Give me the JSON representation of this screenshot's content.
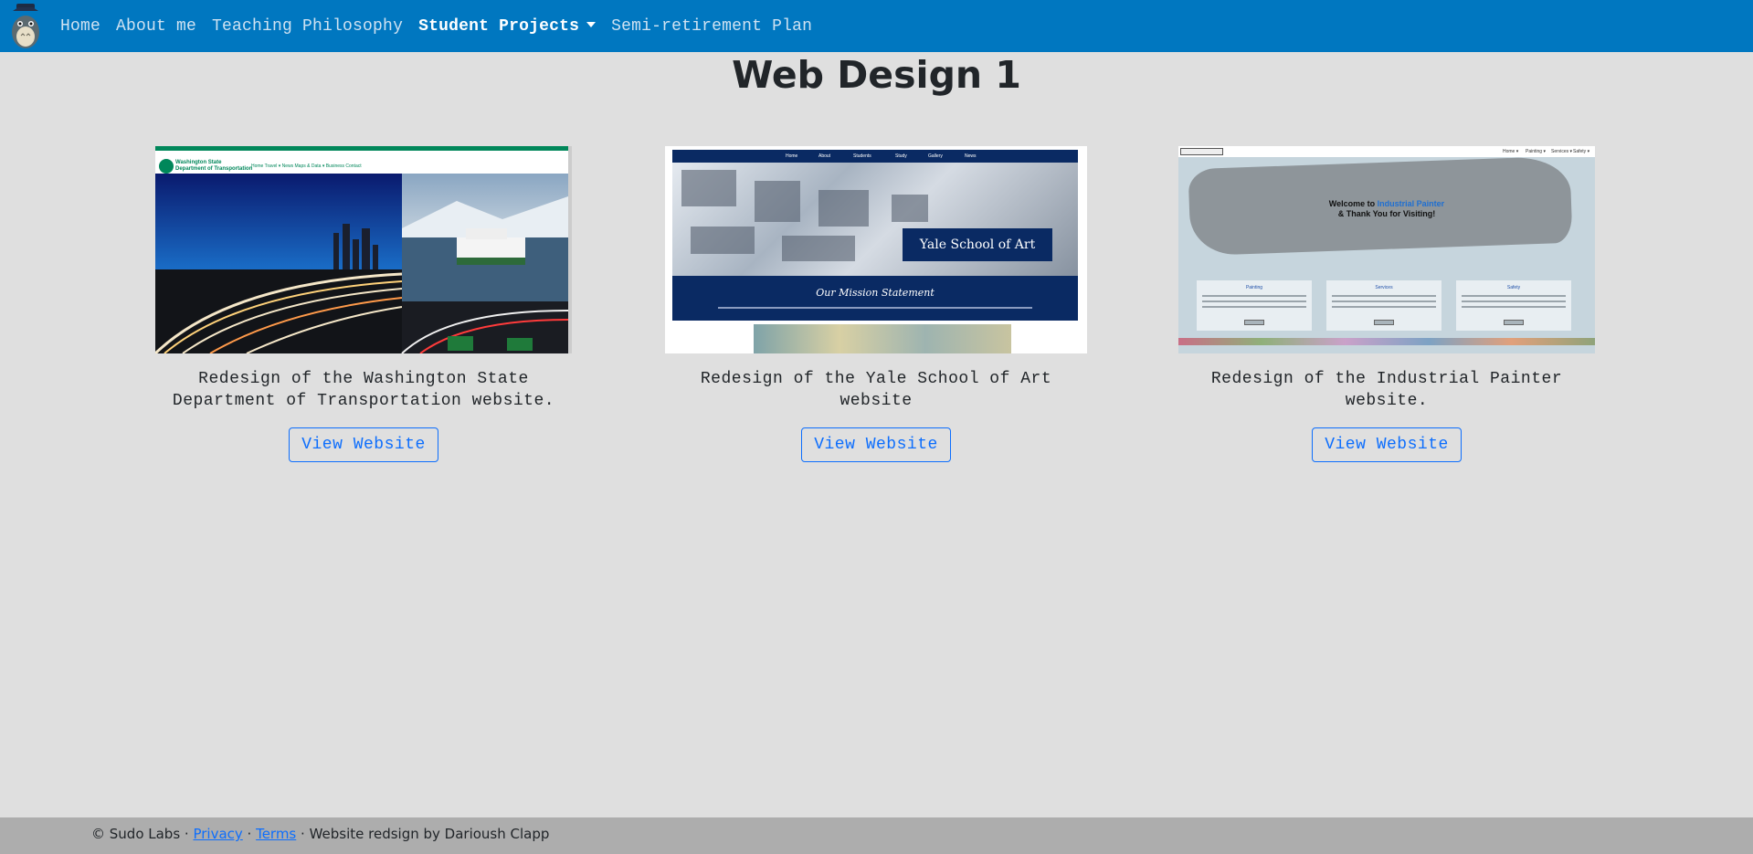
{
  "nav": {
    "items": [
      {
        "label": "Home"
      },
      {
        "label": "About me"
      },
      {
        "label": "Teaching Philosophy"
      },
      {
        "label": "Student Projects",
        "active": true,
        "dropdown": true
      },
      {
        "label": "Semi-retirement Plan"
      }
    ],
    "brand_icon": "totoro-logo-icon",
    "background": "#0077c0"
  },
  "page": {
    "title": "Web Design 1"
  },
  "projects": [
    {
      "caption_line1": "Redesign of the Washington State",
      "caption_line2": "Department of Transportation website.",
      "button": "View Website",
      "thumb": {
        "logo_line1": "Washington State",
        "logo_line2": "Department of Transportation",
        "links": "Home   Travel ▾   News   Maps & Data ▾   Business   Contact"
      }
    },
    {
      "caption_line1": "Redesign of the Yale School of Art website",
      "caption_line2": "",
      "button": "View Website",
      "thumb": {
        "nav": [
          "Home",
          "About",
          "Students",
          "Study",
          "Gallery",
          "News"
        ],
        "box_title": "Yale School of Art",
        "band_title": "Our Mission Statement"
      }
    },
    {
      "caption_line1": "Redesign of the Industrial Painter",
      "caption_line2": "website.",
      "button": "View Website",
      "thumb": {
        "nav": [
          "Home ▾",
          "Painting ▾",
          "Services ▾",
          "Safety ▾"
        ],
        "welcome_prefix": "Welcome to ",
        "welcome_brand": "Industrial Painter",
        "welcome_line2": "& Thank You for Visiting!",
        "cards": [
          "Painting",
          "Services",
          "Safety"
        ]
      }
    }
  ],
  "footer": {
    "copyright": "© Sudo Labs · ",
    "privacy": "Privacy",
    "sep": " · ",
    "terms": "Terms",
    "credit": " · Website redsign by Darioush Clapp"
  },
  "colors": {
    "page_bg": "#dfdfdf",
    "footer_bg": "#adadad",
    "button_accent": "#0d6efd"
  }
}
